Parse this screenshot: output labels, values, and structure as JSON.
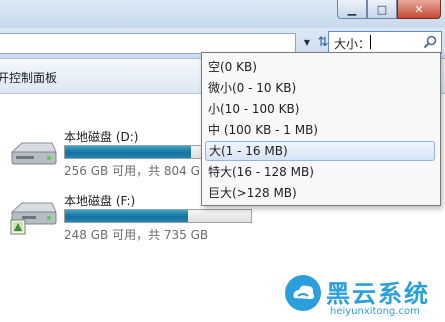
{
  "window": {
    "minimize_glyph": "▁",
    "maximize_glyph": "□",
    "close_glyph": "✕"
  },
  "addressbar": {
    "dropdown_glyph": "▼",
    "refresh_glyph": "⇅"
  },
  "search": {
    "value": "大小："
  },
  "toolbar": {
    "item_label": "开控制面板"
  },
  "drives": [
    {
      "name": "本地磁盘 (D:)",
      "info": "256 GB 可用，共 804 GB",
      "used_fraction": 0.68
    },
    {
      "name": "本地磁盘 (F:)",
      "info": "248 GB 可用，共 735 GB",
      "used_fraction": 0.66
    }
  ],
  "size_filter": {
    "options": [
      {
        "label": "空(0 KB)"
      },
      {
        "label": "微小(0 - 10 KB)"
      },
      {
        "label": "小(10 - 100 KB)"
      },
      {
        "label": "中 (100 KB - 1 MB)"
      },
      {
        "label": "大(1 - 16 MB)",
        "selected": true
      },
      {
        "label": "特大(16 - 128 MB)"
      },
      {
        "label": "巨大(>128 MB)"
      }
    ]
  },
  "watermark": {
    "title": "黑云系统",
    "url": "heiyunxitong.com"
  },
  "colors": {
    "accent": "#2a9fdc",
    "drive_bar": "#1a6f9c",
    "selection_border": "#8db2e3"
  }
}
